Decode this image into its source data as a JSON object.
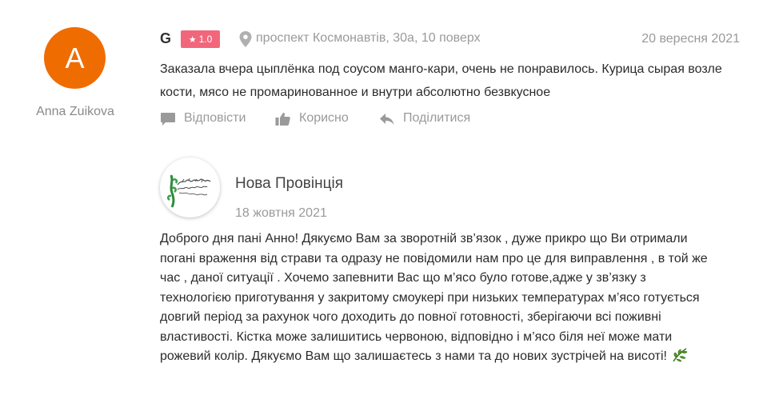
{
  "review": {
    "avatar_letter": "A",
    "reviewer_name": "Anna Zuikova",
    "source_icon": "G",
    "rating": "1.0",
    "address": "проспект Космонавтів, 30а, 10 поверх",
    "date": "20 вересня 2021",
    "text": "Заказала вчера цыплёнка под соусом манго-кари, очень не понравилось. Курица сырая возле кости, мясо не промаринованное и внутри абсолютно безвкусное",
    "actions": {
      "reply_label": "Відповісти",
      "useful_label": "Корисно",
      "share_label": "Поділитися"
    }
  },
  "reply": {
    "name": "Нова Провінція",
    "date": "18 жовтня 2021",
    "text": " Доброго дня пані Анно! Дякуємо Вам за зворотній зв’язок , дуже прикро що Ви отримали погані враження від страви та одразу не повідомили нам про це для виправлення , в той же час , даної ситуації . Хочемо запевнити Вас що м’ясо було готове,адже у зв’язку з технологією приготування у закритому смоукері при низьких температурах м’ясо готується довгий період за рахунок чого доходить до повної готовності, зберігаючи всі поживні властивості. Кістка може залишитись червоною, відповідно і м’ясо біля неї може мати рожевий колір. Дякуємо Вам що залишаєтесь з нами та до нових зустрічей на висоті!"
  },
  "colors": {
    "avatar_bg": "#ef6c00",
    "rating_badge_bg": "#f2667c",
    "muted_text": "#9a9a9a"
  }
}
